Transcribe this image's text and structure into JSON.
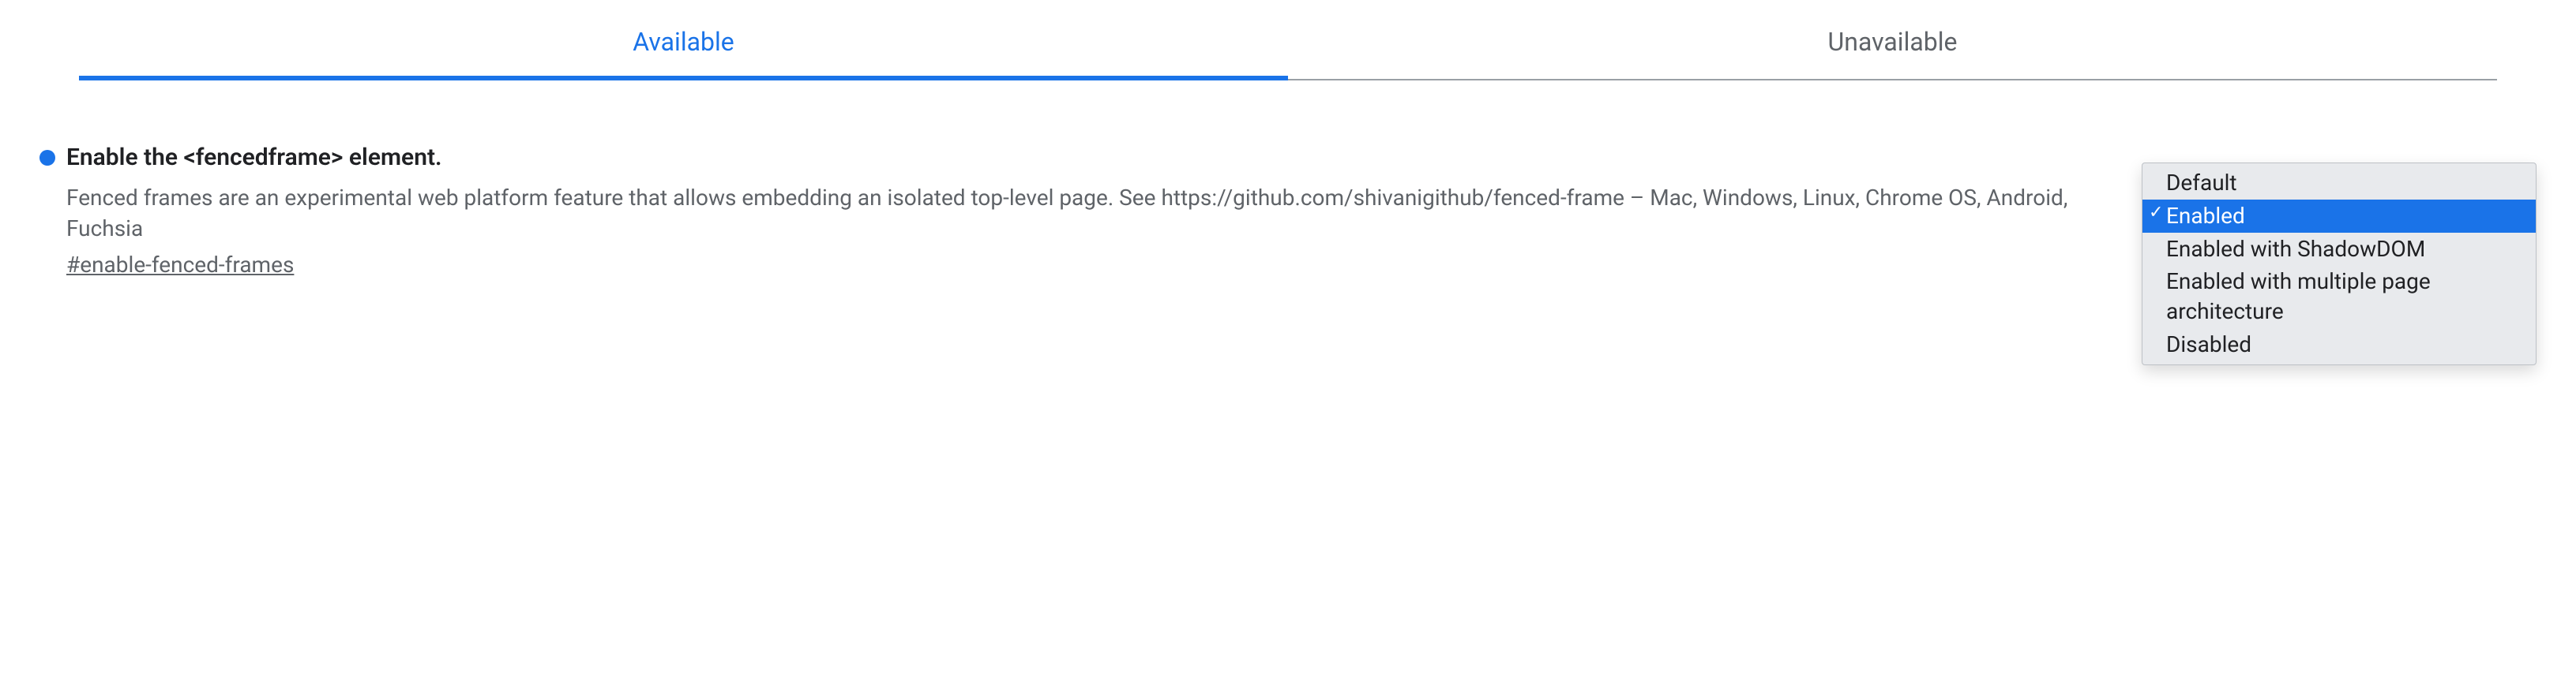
{
  "tabs": {
    "available": "Available",
    "unavailable": "Unavailable"
  },
  "flag": {
    "title": "Enable the <fencedframe> element.",
    "description": "Fenced frames are an experimental web platform feature that allows embedding an isolated top-level page. See https://github.com/shivanigithub/fenced-frame – Mac, Windows, Linux, Chrome OS, Android, Fuchsia",
    "hash": "#enable-fenced-frames"
  },
  "dropdown": {
    "options": [
      {
        "label": "Default"
      },
      {
        "label": "Enabled"
      },
      {
        "label": "Enabled with ShadowDOM"
      },
      {
        "label": "Enabled with multiple page architecture"
      },
      {
        "label": "Disabled"
      }
    ],
    "selected_index": 1
  }
}
